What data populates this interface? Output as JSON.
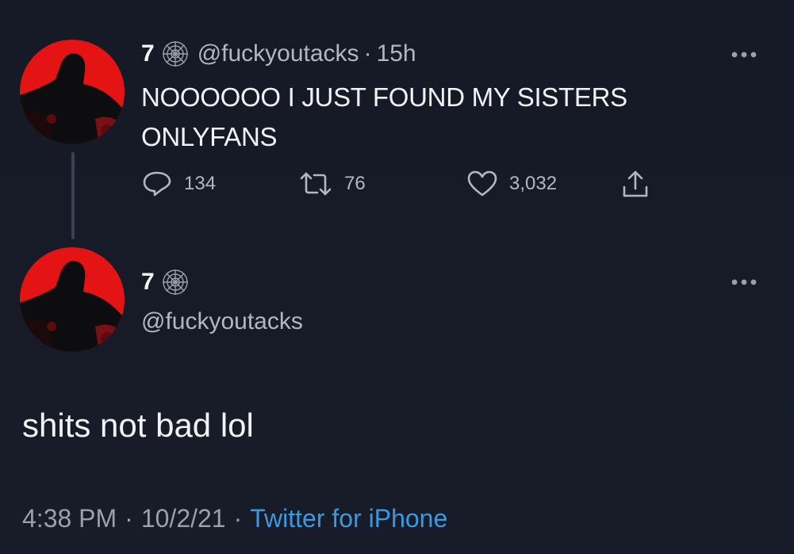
{
  "tweet": {
    "display_name": "7",
    "handle": "@fuckyoutacks",
    "separator": "·",
    "time_ago": "15h",
    "text_line1": "NOOOOOO I JUST FOUND MY SISTERS",
    "text_line2": "ONLYFANS",
    "stats": {
      "replies": "134",
      "retweets": "76",
      "likes": "3,032"
    }
  },
  "reply": {
    "display_name": "7",
    "handle": "@fuckyoutacks",
    "text": "shits not bad lol",
    "time": "4:38 PM",
    "date": "10/2/21",
    "separator": "·",
    "source": "Twitter for iPhone"
  },
  "icons": {
    "name_badge": "spider-web-icon",
    "more": "more-dots-icon",
    "reply": "reply-icon",
    "retweet": "retweet-icon",
    "like": "heart-icon",
    "share": "share-icon"
  },
  "colors": {
    "background": "#161b27",
    "text_primary": "#f1f2f4",
    "text_secondary": "#b2b8c0",
    "link_blue": "#3c99e0",
    "avatar_red": "#e01414"
  }
}
